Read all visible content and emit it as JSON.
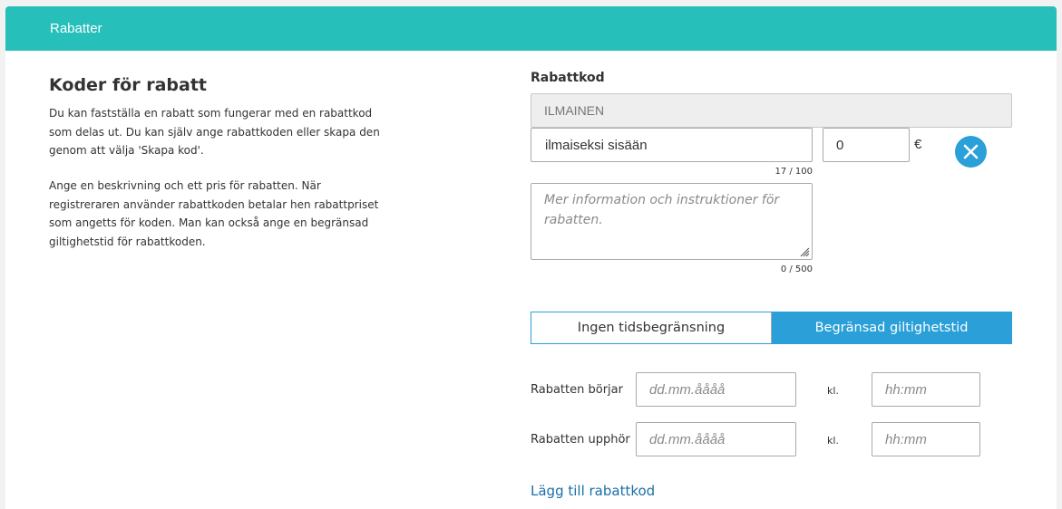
{
  "header": {
    "title": "Rabatter"
  },
  "intro": {
    "title": "Koder för rabatt",
    "paragraph1": "Du kan fastställa en rabatt som fungerar med en rabattkod som delas ut. Du kan själv ange rabattkoden eller skapa den genom att välja 'Skapa kod'.",
    "paragraph2": "Ange en beskrivning och ett pris för rabatten. När registreraren använder rabattkoden betalar hen rabattpriset som angetts för koden. Man kan också ange en begränsad giltighetstid för rabattkoden."
  },
  "form": {
    "code_label": "Rabattkod",
    "code_value": "ILMAINEN",
    "name_value": "ilmaiseksi sisään",
    "name_counter": "17 / 100",
    "price_value": "0",
    "currency": "€",
    "description_placeholder": "Mer information och instruktioner för rabatten.",
    "description_counter": "0 / 500",
    "remove_icon": "close-circle-icon",
    "accent_color": "#2a9fd8"
  },
  "validity": {
    "options": [
      "Ingen tidsbegränsning",
      "Begränsad giltighetstid"
    ],
    "selected": "Begränsad giltighetstid"
  },
  "start": {
    "label": "Rabatten börjar",
    "date_placeholder": "dd.mm.åååå",
    "time_label": "kl.",
    "time_placeholder": "hh:mm"
  },
  "end": {
    "label": "Rabatten upphör",
    "date_placeholder": "dd.mm.åååå",
    "time_label": "kl.",
    "time_placeholder": "hh:mm"
  },
  "add_link": "Lägg till rabattkod",
  "colors": {
    "header": "#26bfb9",
    "link": "#1a6fa8"
  }
}
